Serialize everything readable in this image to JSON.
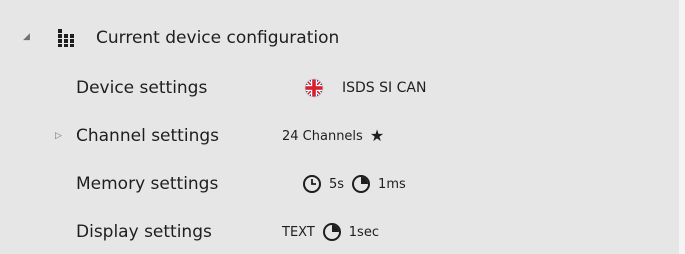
{
  "tree": {
    "root": {
      "label": "Current device configuration",
      "expander_icon": "triangle-expanded",
      "icon": "grid-icon"
    },
    "rows": [
      {
        "label": "Device settings",
        "value": {
          "flag_icon": "uk-flag-icon",
          "text": "ISDS SI CAN"
        }
      },
      {
        "label": "Channel settings",
        "expander_icon": "triangle-collapsed",
        "value": {
          "text": "24 Channels",
          "star_icon": "star-icon",
          "star_glyph": "★"
        }
      },
      {
        "label": "Memory settings",
        "value": {
          "clock_icon": "clock-icon",
          "clock_text": "5s",
          "pie_icon": "pie-clock-icon",
          "pie_text": "1ms"
        }
      },
      {
        "label": "Display settings",
        "value": {
          "mode_text": "TEXT",
          "pie_icon": "pie-clock-icon",
          "pie_text": "1sec"
        }
      }
    ]
  },
  "colors": {
    "panel_bg": "#e6e6e6",
    "text": "#1e1e1e",
    "flag_red": "#d8202c",
    "flag_blue": "#1f3c8c"
  }
}
